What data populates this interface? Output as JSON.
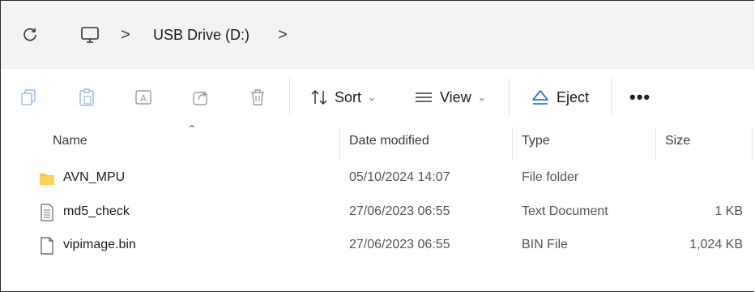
{
  "address": {
    "location": "USB Drive (D:)",
    "separator": ">"
  },
  "toolbar": {
    "sort_label": "Sort",
    "view_label": "View",
    "eject_label": "Eject",
    "more_label": "•••"
  },
  "columns": {
    "name": "Name",
    "date": "Date modified",
    "type": "Type",
    "size": "Size"
  },
  "files": [
    {
      "name": "AVN_MPU",
      "date": "05/10/2024 14:07",
      "type": "File folder",
      "size": "",
      "icon": "folder-icon"
    },
    {
      "name": "md5_check",
      "date": "27/06/2023 06:55",
      "type": "Text Document",
      "size": "1 KB",
      "icon": "text-document-icon"
    },
    {
      "name": "vipimage.bin",
      "date": "27/06/2023 06:55",
      "type": "BIN File",
      "size": "1,024 KB",
      "icon": "file-icon"
    }
  ],
  "colors": {
    "folder": "#f5c244",
    "accent": "#0a64c8"
  }
}
